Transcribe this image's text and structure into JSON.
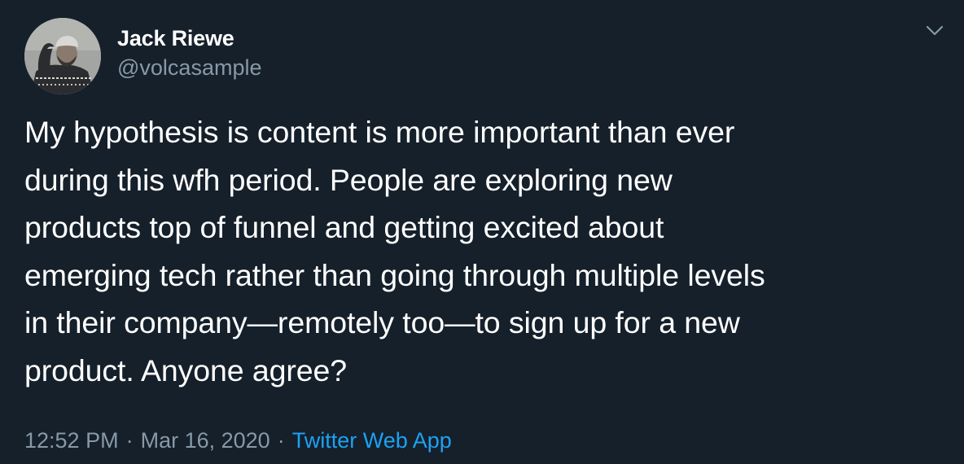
{
  "tweet": {
    "author": {
      "display_name": "Jack Riewe",
      "handle": "@volcasample"
    },
    "text": "My hypothesis is content is more important than ever\nduring this wfh period. People are exploring new\nproducts top of funnel and getting excited about\nemerging tech rather than going through multiple levels\nin their company—remotely too—to sign up for a new\nproduct. Anyone agree?",
    "time": "12:52 PM",
    "date": "Mar 16, 2020",
    "separator": "·",
    "source": "Twitter Web App",
    "menu_icon": "chevron-down-icon"
  },
  "colors": {
    "background": "#15202b",
    "text": "#ffffff",
    "secondary": "#8899a6",
    "link": "#1da1f2"
  }
}
